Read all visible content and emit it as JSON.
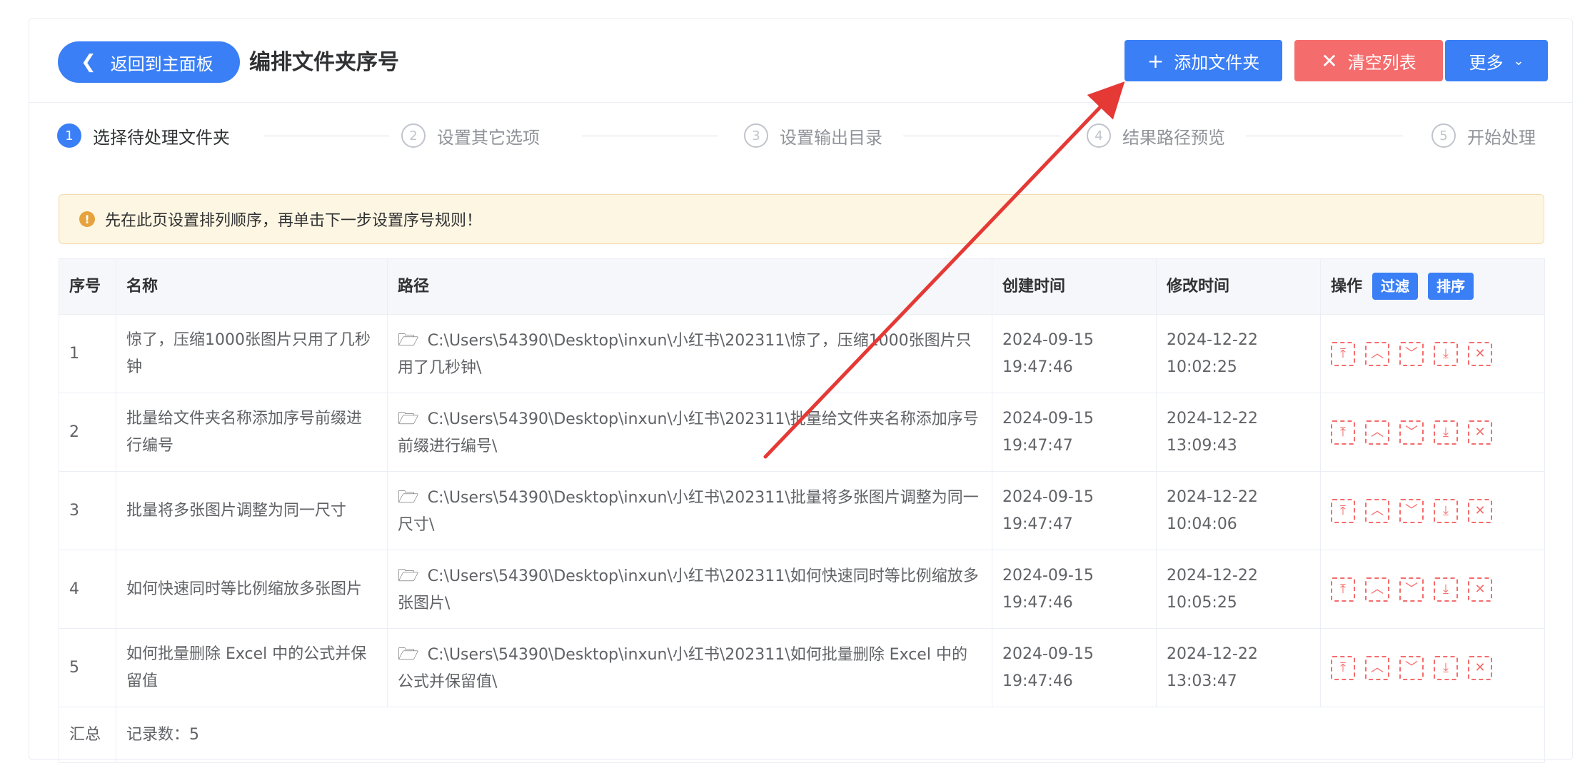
{
  "header": {
    "back_label": "返回到主面板",
    "title": "编排文件夹序号",
    "add_label": "添加文件夹",
    "clear_label": "清空列表",
    "more_label": "更多"
  },
  "steps": [
    {
      "num": "1",
      "label": "选择待处理文件夹"
    },
    {
      "num": "2",
      "label": "设置其它选项"
    },
    {
      "num": "3",
      "label": "设置输出目录"
    },
    {
      "num": "4",
      "label": "结果路径预览"
    },
    {
      "num": "5",
      "label": "开始处理"
    }
  ],
  "alert": {
    "text": "先在此页设置排列顺序，再单击下一步设置序号规则！"
  },
  "table": {
    "headers": {
      "index": "序号",
      "name": "名称",
      "path": "路径",
      "created": "创建时间",
      "modified": "修改时间",
      "ops": "操作",
      "filter": "过滤",
      "sort": "排序"
    },
    "rows": [
      {
        "index": "1",
        "name": "惊了，压缩1000张图片只用了几秒钟",
        "path": "C:\\Users\\54390\\Desktop\\inxun\\小红书\\202311\\惊了，压缩1000张图片只用了几秒钟\\",
        "created": "2024-09-15 19:47:46",
        "modified": "2024-12-22 10:02:25"
      },
      {
        "index": "2",
        "name": "批量给文件夹名称添加序号前缀进行编号",
        "path": "C:\\Users\\54390\\Desktop\\inxun\\小红书\\202311\\批量给文件夹名称添加序号前缀进行编号\\",
        "created": "2024-09-15 19:47:47",
        "modified": "2024-12-22 13:09:43"
      },
      {
        "index": "3",
        "name": "批量将多张图片调整为同一尺寸",
        "path": "C:\\Users\\54390\\Desktop\\inxun\\小红书\\202311\\批量将多张图片调整为同一尺寸\\",
        "created": "2024-09-15 19:47:47",
        "modified": "2024-12-22 10:04:06"
      },
      {
        "index": "4",
        "name": "如何快速同时等比例缩放多张图片",
        "path": "C:\\Users\\54390\\Desktop\\inxun\\小红书\\202311\\如何快速同时等比例缩放多张图片\\",
        "created": "2024-09-15 19:47:46",
        "modified": "2024-12-22 10:05:25"
      },
      {
        "index": "5",
        "name": "如何批量删除 Excel 中的公式并保留值",
        "path": "C:\\Users\\54390\\Desktop\\inxun\\小红书\\202311\\如何批量删除 Excel 中的公式并保留值\\",
        "created": "2024-09-15 19:47:46",
        "modified": "2024-12-22 13:03:47"
      }
    ],
    "summary": {
      "label": "汇总",
      "count": "记录数：5"
    }
  },
  "icons": {
    "back": "chevron-left-icon",
    "add": "plus-icon",
    "clear": "close-icon",
    "more": "chevron-down-icon",
    "alert": "warning-icon",
    "folder": "folder-icon",
    "ops": [
      "move-top-icon",
      "move-up-icon",
      "move-down-icon",
      "move-bottom-icon",
      "delete-icon"
    ]
  },
  "colors": {
    "primary": "#3a7ff6",
    "danger": "#f56c6c",
    "warning": "#e6a23c",
    "annotation_arrow": "#e53935"
  }
}
